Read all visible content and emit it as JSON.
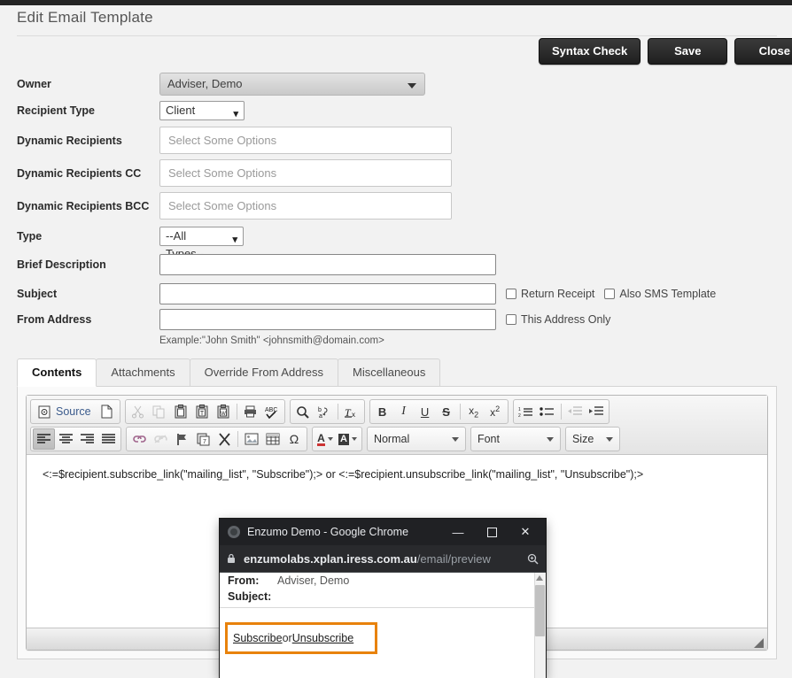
{
  "page": {
    "title": "Edit Email Template"
  },
  "actions": {
    "syntax_check": "Syntax Check",
    "save": "Save",
    "close": "Close"
  },
  "form": {
    "owner": {
      "label": "Owner",
      "value": "Adviser, Demo"
    },
    "recipient_type": {
      "label": "Recipient Type",
      "value": "Client"
    },
    "dynamic_recipients": {
      "label": "Dynamic Recipients",
      "placeholder": "Select Some Options",
      "value": ""
    },
    "dynamic_recipients_cc": {
      "label": "Dynamic Recipients CC",
      "placeholder": "Select Some Options",
      "value": ""
    },
    "dynamic_recipients_bcc": {
      "label": "Dynamic Recipients BCC",
      "placeholder": "Select Some Options",
      "value": ""
    },
    "type": {
      "label": "Type",
      "value": "--All Types--"
    },
    "brief_description": {
      "label": "Brief Description",
      "value": ""
    },
    "subject": {
      "label": "Subject",
      "value": ""
    },
    "from_address": {
      "label": "From Address",
      "value": "",
      "hint": "Example:\"John Smith\" <johnsmith@domain.com>"
    },
    "return_receipt": {
      "label": "Return Receipt",
      "checked": false
    },
    "also_sms_template": {
      "label": "Also SMS Template",
      "checked": false
    },
    "this_address_only": {
      "label": "This Address Only",
      "checked": false
    }
  },
  "tabs": [
    {
      "label": "Contents",
      "active": true
    },
    {
      "label": "Attachments",
      "active": false
    },
    {
      "label": "Override From Address",
      "active": false
    },
    {
      "label": "Miscellaneous",
      "active": false
    }
  ],
  "editor": {
    "source_label": "Source",
    "paragraph_format": "Normal",
    "font": "Font",
    "size": "Size",
    "content": "<:=$recipient.subscribe_link(\"mailing_list\", \"Subscribe\");> or <:=$recipient.unsubscribe_link(\"mailing_list\", \"Unsubscribe\");>"
  },
  "popup": {
    "window_title": "Enzumo Demo - Google Chrome",
    "minimize": "—",
    "maximize": "☐",
    "close": "✕",
    "url_domain": "enzumolabs.xplan.iress.com.au",
    "url_path": "/email/preview",
    "preview": {
      "from_label": "From:",
      "from_value": "Adviser, Demo",
      "subject_label": "Subject:",
      "subject_value": "",
      "link_subscribe": "Subscribe",
      "link_or": " or ",
      "link_unsubscribe": "Unsubscribe"
    }
  },
  "colors": {
    "highlight_box": "#e8820c",
    "button_dark": "#1f1f1f",
    "chrome_title_bg": "#202124",
    "page_bg": "#f2f2f2"
  }
}
